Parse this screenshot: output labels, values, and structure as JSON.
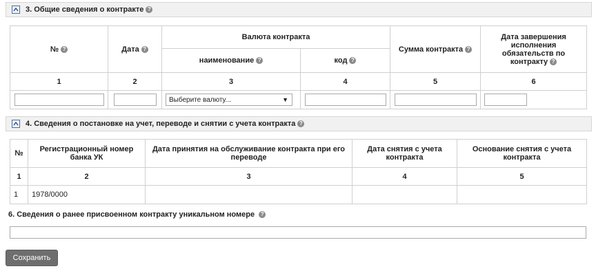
{
  "section3": {
    "title": "3. Общие сведения о контракте",
    "headers": {
      "number": "№",
      "date": "Дата",
      "currency_group": "Валюта контракта",
      "currency_name": "наименование",
      "currency_code": "код",
      "sum": "Сумма контракта",
      "end_date": "Дата завершения исполнения обязательств по контракту"
    },
    "col_numbers": [
      "1",
      "2",
      "3",
      "4",
      "5",
      "6"
    ],
    "currency_select": {
      "selected": "Выберите валюту..."
    }
  },
  "section4": {
    "title": "4. Сведения о постановке на учет, переводе и снятии с учета контракта",
    "headers": {
      "number": "№",
      "reg_number": "Регистрационный номер банка УК",
      "accept_date": "Дата принятия на обслуживание контракта при его переводе",
      "removal_date": "Дата снятия с учета контракта",
      "removal_reason": "Основание снятия с учета контракта"
    },
    "col_numbers": [
      "1",
      "2",
      "3",
      "4",
      "5"
    ],
    "rows": [
      {
        "num": "1",
        "reg_number": "1978/0000",
        "accept_date": "",
        "removal_date": "",
        "removal_reason": ""
      }
    ]
  },
  "section6": {
    "title": "6. Сведения о ранее присвоенном контракту уникальном номере"
  },
  "actions": {
    "save_label": "Сохранить"
  },
  "icons": {
    "collapse": "collapse-icon",
    "help": "help-icon"
  }
}
